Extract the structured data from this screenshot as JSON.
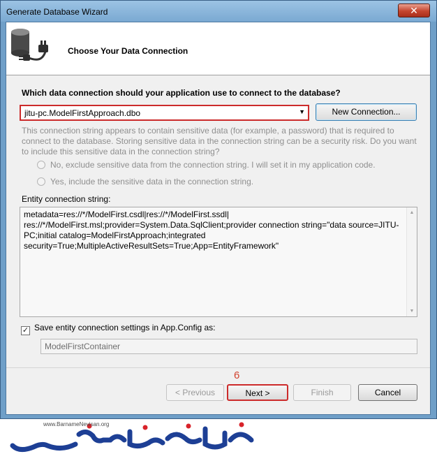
{
  "window": {
    "title": "Generate Database Wizard",
    "close_glyph": "✕"
  },
  "header": {
    "title": "Choose Your Data Connection",
    "icon": "database-plug-icon"
  },
  "connection": {
    "question": "Which data connection should your application use to connect to the database?",
    "selected": "jitu-pc.ModelFirstApproach.dbo",
    "new_connection_label": "New Connection...",
    "sensitive_warning": "This connection string appears to contain sensitive data (for example, a password) that is required to connect to the database. Storing sensitive data in the connection string can be a security risk. Do you want to include this sensitive data in the connection string?",
    "option_exclude": "No, exclude sensitive data from the connection string. I will set it in my application code.",
    "option_include": "Yes, include the sensitive data in the connection string."
  },
  "entity": {
    "label": "Entity connection string:",
    "value": "metadata=res://*/ModelFirst.csdl|res://*/ModelFirst.ssdl|\nres://*/ModelFirst.msl;provider=System.Data.SqlClient;provider connection string=\"data source=JITU-PC;initial catalog=ModelFirstApproach;integrated security=True;MultipleActiveResultSets=True;App=EntityFramework\""
  },
  "save": {
    "checked": true,
    "label": "Save entity connection settings in App.Config as:",
    "container_name": "ModelFirstContainer"
  },
  "footer": {
    "step_number": "6",
    "previous_label": "< Previous",
    "next_label": "Next >",
    "finish_label": "Finish",
    "cancel_label": "Cancel"
  },
  "watermark": {
    "url": "www.BarnameNevisan.org",
    "logo": "barnamenevisan-logo"
  },
  "colors": {
    "highlight": "#cc2b2b",
    "titlebar": "#7aa9d2",
    "logo_blue": "#1d3f95",
    "logo_red": "#d8232a"
  }
}
